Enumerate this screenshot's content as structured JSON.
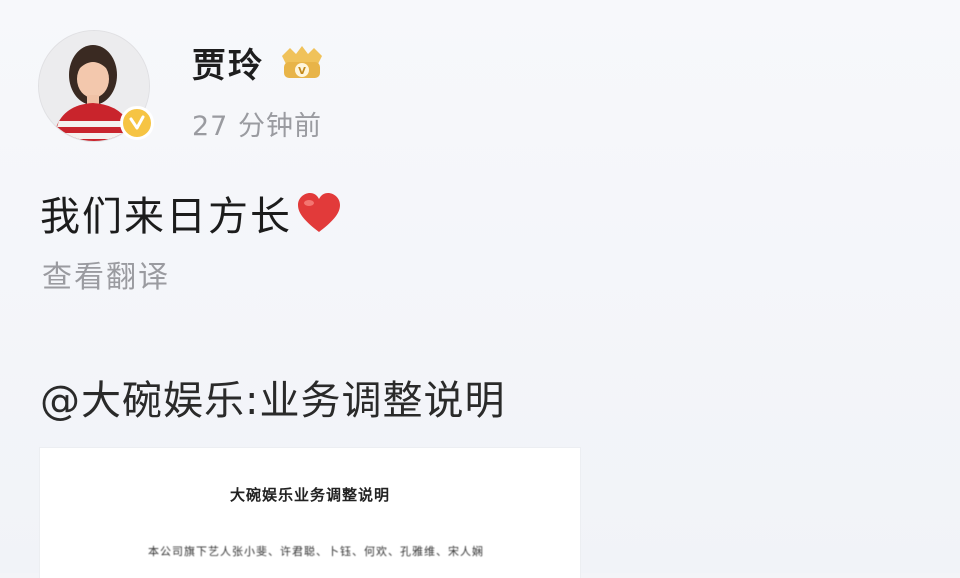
{
  "post": {
    "author_name": "贾玲",
    "timestamp": "27 分钟前",
    "content_text": "我们来日方长",
    "translate_label": "查看翻译",
    "repost_link_text": "@大碗娱乐:业务调整说明",
    "document": {
      "title": "大碗娱乐业务调整说明",
      "first_line": "本公司旗下艺人张小斐、许君聪、卜钰、何欢、孔雅维、宋人娴"
    }
  },
  "colors": {
    "verified_badge": "#f6c443",
    "heart": "#e23a3a",
    "vip_badge": "#e8b448",
    "secondary_text": "#9a9ba0"
  },
  "icons": {
    "verified": "verified-badge-icon",
    "vip": "vip-crown-icon",
    "heart": "red-heart-emoji-icon"
  }
}
